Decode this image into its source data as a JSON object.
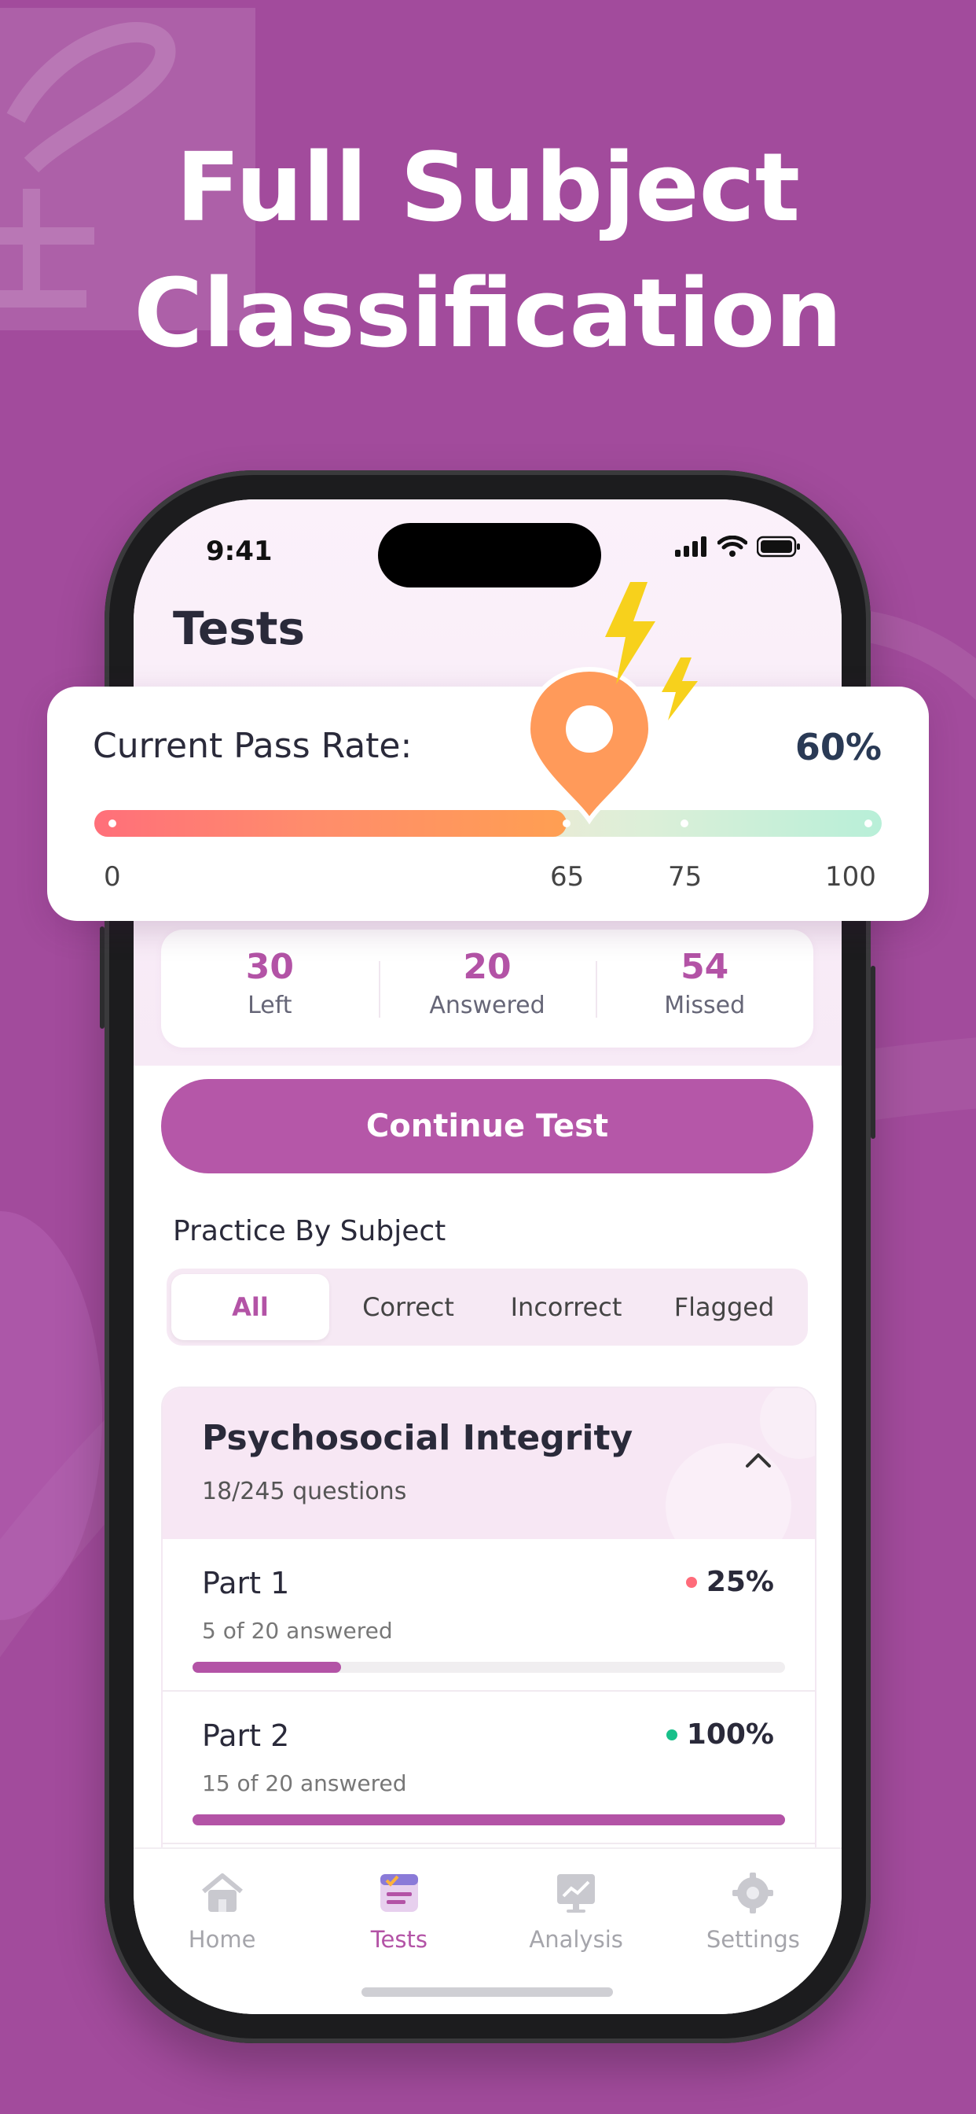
{
  "headline": {
    "line1": "Full Subject",
    "line2": "Classification"
  },
  "status_bar": {
    "time": "9:41"
  },
  "screen_title": "Tests",
  "pass_rate": {
    "label": "Current Pass Rate:",
    "value_text": "60%",
    "value": 60,
    "ticks": [
      "0",
      "65",
      "75",
      "100"
    ]
  },
  "stats": [
    {
      "num": "30",
      "label": "Left"
    },
    {
      "num": "20",
      "label": "Answered"
    },
    {
      "num": "54",
      "label": "Missed"
    }
  ],
  "continue_label": "Continue Test",
  "practice_title": "Practice By Subject",
  "filters": [
    "All",
    "Correct",
    "Incorrect",
    "Flagged"
  ],
  "subject": {
    "title": "Psychosocial Integrity",
    "sub": "18/245 questions",
    "parts": [
      {
        "title": "Part 1",
        "sub": "5 of 20 answered",
        "pct": "25%",
        "progress": 0.25,
        "dot_color": "#ff6b7a"
      },
      {
        "title": "Part 2",
        "sub": "15 of 20 answered",
        "pct": "100%",
        "progress": 1.0,
        "dot_color": "#18c08a"
      }
    ]
  },
  "tabs": [
    {
      "label": "Home",
      "icon": "home-icon"
    },
    {
      "label": "Tests",
      "icon": "tests-icon"
    },
    {
      "label": "Analysis",
      "icon": "analysis-icon"
    },
    {
      "label": "Settings",
      "icon": "settings-icon"
    }
  ],
  "colors": {
    "background": "#a24b9c",
    "accent": "#b353a6",
    "pin": "#ff9a5a",
    "bolt": "#f7d11c"
  }
}
